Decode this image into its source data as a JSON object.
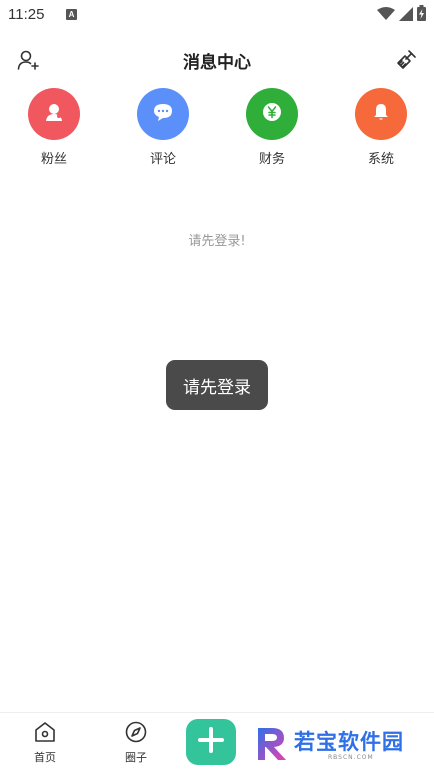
{
  "status_bar": {
    "time": "11:25",
    "indicator": "A",
    "icons": [
      "wifi-icon",
      "signal-icon",
      "battery-charging-icon"
    ]
  },
  "header": {
    "title": "消息中心",
    "left_icon": "add-user-icon",
    "right_icon": "broom-icon"
  },
  "quick_actions": [
    {
      "label": "粉丝",
      "icon": "person-icon",
      "color": "#f0575f"
    },
    {
      "label": "评论",
      "icon": "chat-bubble-icon",
      "color": "#5b8ff9"
    },
    {
      "label": "财务",
      "icon": "yen-coin-icon",
      "color": "#2fae3a"
    },
    {
      "label": "系统",
      "icon": "bell-icon",
      "color": "#f5693a"
    }
  ],
  "main": {
    "empty_message": "请先登录!"
  },
  "toast": {
    "message": "请先登录"
  },
  "tabbar": {
    "items": [
      {
        "label": "首页",
        "icon": "home-icon"
      },
      {
        "label": "圈子",
        "icon": "compass-icon"
      }
    ],
    "add_icon": "plus-icon",
    "add_color": "#33c49b"
  },
  "watermark": {
    "text": "若宝软件园",
    "subtext": "RBSCN.COM"
  }
}
